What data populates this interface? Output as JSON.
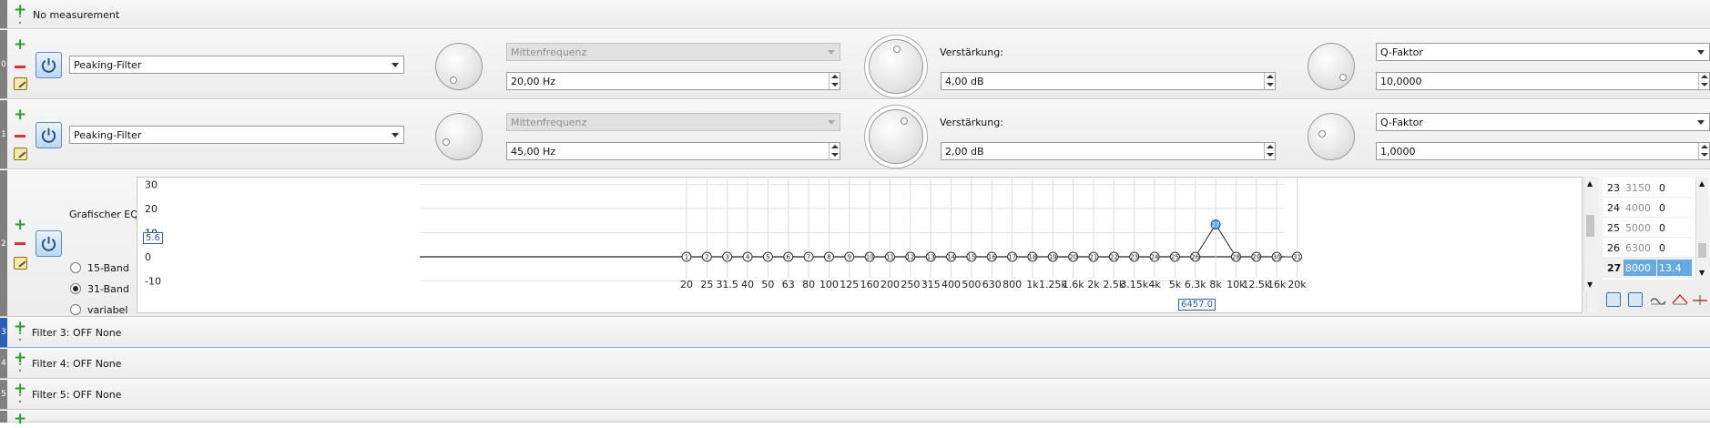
{
  "top_row": {
    "label": "No measurement"
  },
  "filters": [
    {
      "number": "0",
      "type": "Peaking-Filter",
      "freq_label": "Mittenfrequenz",
      "freq_value": "20,00 Hz",
      "gain_label": "Verstärkung:",
      "gain_value": "4,00 dB",
      "q_label": "Q-Faktor",
      "q_value": "10,0000"
    },
    {
      "number": "1",
      "type": "Peaking-Filter",
      "freq_label": "Mittenfrequenz",
      "freq_value": "45,00 Hz",
      "gain_label": "Verstärkung:",
      "gain_value": "2,00 dB",
      "q_label": "Q-Faktor",
      "q_value": "1,0000"
    }
  ],
  "geq": {
    "number": "2",
    "title": "Grafischer EQ:",
    "cursor_value": "5.6",
    "cursor_freq": "6457.0",
    "modes": [
      "15-Band",
      "31-Band",
      "variabel"
    ],
    "selected_mode": "31-Band",
    "table": [
      {
        "band": "23",
        "freq": "3150",
        "gain": "0"
      },
      {
        "band": "24",
        "freq": "4000",
        "gain": "0"
      },
      {
        "band": "25",
        "freq": "5000",
        "gain": "0"
      },
      {
        "band": "26",
        "freq": "6300",
        "gain": "0"
      },
      {
        "band": "27",
        "freq": "8000",
        "gain": "13.4"
      }
    ],
    "selected_band": "27",
    "toolbar_icons": [
      "save-icon",
      "load-icon",
      "flat-curve-icon",
      "smooth-curve-icon",
      "reset-curve-icon"
    ]
  },
  "chart_data": {
    "type": "line",
    "y_ticks": [
      "30",
      "20",
      "10",
      "0",
      "-10"
    ],
    "ylim": [
      -15,
      32
    ],
    "x_tick_labels": [
      "20",
      "25",
      "31.5",
      "40",
      "50",
      "63",
      "80",
      "100",
      "125",
      "160",
      "200",
      "250",
      "315",
      "400",
      "500",
      "630",
      "800",
      "1k",
      "1.25k",
      "1.6k",
      "2k",
      "2.5k",
      "3.15k",
      "4k",
      "5k",
      "6.3k",
      "8k",
      "10k",
      "12.5k",
      "16k",
      "20k"
    ],
    "series": [
      {
        "band_numbers": [
          "1",
          "2",
          "3",
          "4",
          "5",
          "6",
          "7",
          "8",
          "9",
          "10",
          "11",
          "12",
          "13",
          "14",
          "15",
          "16",
          "17",
          "18",
          "19",
          "20",
          "21",
          "22",
          "23",
          "24",
          "25",
          "26",
          "27",
          "28",
          "29",
          "30",
          "31"
        ],
        "values": [
          0,
          0,
          0,
          0,
          0,
          0,
          0,
          0,
          0,
          0,
          0,
          0,
          0,
          0,
          0,
          0,
          0,
          0,
          0,
          0,
          0,
          0,
          0,
          0,
          0,
          0,
          13.4,
          0,
          0,
          0,
          0
        ]
      }
    ],
    "grid": true
  },
  "collapsed_filters": [
    {
      "number": "3",
      "label": "Filter  3: OFF None",
      "selected": true
    },
    {
      "number": "4",
      "label": "Filter  4: OFF None",
      "selected": false
    },
    {
      "number": "5",
      "label": "Filter  5: OFF None",
      "selected": false
    }
  ]
}
